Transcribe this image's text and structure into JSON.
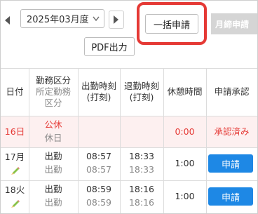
{
  "toolbar": {
    "period_value": "2025年03月度",
    "bulk_apply_label": "一括申請",
    "monthly_close_label": "月締申請",
    "pdf_label": "PDF出力"
  },
  "table": {
    "headers": {
      "date": "日付",
      "category_main": "勤務区分",
      "category_sub1": "所定勤務",
      "category_sub2": "区分",
      "clock_in_1": "出勤時刻",
      "clock_in_2": "(打刻)",
      "clock_out_1": "退勤時刻",
      "clock_out_2": "(打刻)",
      "break": "休憩時間",
      "approval": "申請承認"
    },
    "rows": [
      {
        "date": "16日",
        "category": "公休",
        "scheduled": "休日",
        "clock_in": "",
        "clock_in_stamp": "",
        "clock_out": "",
        "clock_out_stamp": "",
        "break": "0:00",
        "approval": "承認済み"
      },
      {
        "date": "17月",
        "category": "出勤",
        "scheduled": "出勤",
        "clock_in": "08:57",
        "clock_in_stamp": "08:57",
        "clock_out": "18:33",
        "clock_out_stamp": "18:33",
        "break": "1:00",
        "approval": "申請"
      },
      {
        "date": "18火",
        "category": "出勤",
        "scheduled": "出勤",
        "clock_in": "08:59",
        "clock_in_stamp": "08:59",
        "clock_out": "18:16",
        "clock_out_stamp": "18:16",
        "break": "1:00",
        "approval": "申請"
      }
    ]
  },
  "colors": {
    "accent": "#1e88e5",
    "highlight": "#e53935",
    "holiday_bg": "#fdf0f0"
  },
  "icons": {
    "prev": "caret-left-icon",
    "next": "caret-right-icon",
    "dropdown": "chevron-down-icon",
    "edit": "pencil-icon"
  }
}
